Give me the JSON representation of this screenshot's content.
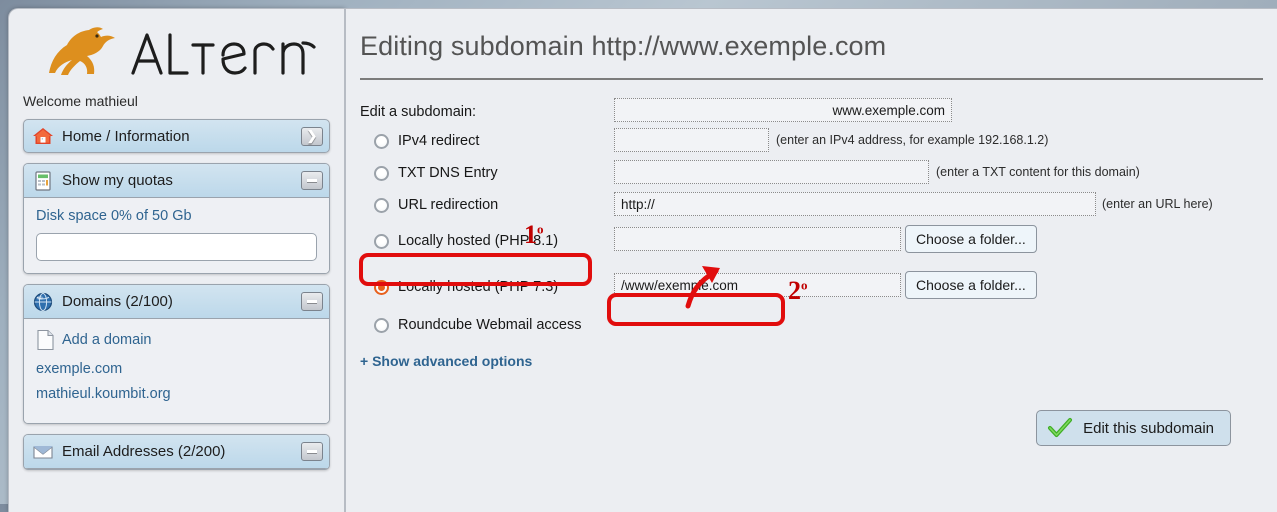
{
  "sidebar": {
    "logo_text": "ALTERNC",
    "logo_icon": "kangaroo-logo",
    "welcome": "Welcome mathieul",
    "nav": {
      "home": {
        "label": "Home / Information",
        "icon": "house-icon",
        "toggle": "chevron-right-icon"
      }
    },
    "panels": [
      {
        "title": "Show my quotas",
        "icon": "quota-report-icon",
        "toggle": "minus-icon",
        "quota_text": "Disk space 0% of 50 Gb",
        "quota_percent": 0
      },
      {
        "title": "Domains (2/100)",
        "icon": "globe-icon",
        "toggle": "minus-icon",
        "add_label": "Add a domain",
        "add_icon": "document-icon",
        "items": [
          "exemple.com",
          "mathieul.koumbit.org"
        ]
      },
      {
        "title": "Email Addresses (2/200)",
        "icon": "envelope-icon",
        "toggle": "minus-icon"
      }
    ]
  },
  "main": {
    "page_title": "Editing subdomain http://www.exemple.com",
    "form_label": "Edit a subdomain:",
    "subdomain_value": "www.exemple.com",
    "options": [
      {
        "id": "ipv4",
        "label": "IPv4 redirect",
        "checked": false,
        "value": "",
        "hint": "(enter an IPv4 address, for example 192.168.1.2)"
      },
      {
        "id": "txt",
        "label": "TXT DNS Entry",
        "checked": false,
        "value": "",
        "hint": "(enter a TXT content for this domain)"
      },
      {
        "id": "url",
        "label": "URL redirection",
        "checked": false,
        "value": "http://",
        "hint": "(enter an URL here)"
      },
      {
        "id": "php81",
        "label": "Locally hosted (PHP 8.1)",
        "checked": false,
        "value": "",
        "hint": "",
        "button": "Choose a folder..."
      },
      {
        "id": "php73",
        "label": "Locally hosted (PHP 7.3)",
        "checked": true,
        "value": "/www/exemple.com",
        "hint": "",
        "button": "Choose a folder..."
      },
      {
        "id": "roundcube",
        "label": "Roundcube Webmail access",
        "checked": false,
        "value": "",
        "hint": ""
      }
    ],
    "advanced_link": "+ Show advanced options",
    "submit": {
      "label": "Edit this subdomain",
      "icon": "green-check-icon"
    }
  },
  "annotations": {
    "marker_one": "1",
    "marker_one_sup": "o",
    "marker_two": "2",
    "marker_two_sup": "o",
    "color": "#e10d0d",
    "arrow_icon": "curved-arrow-icon"
  }
}
